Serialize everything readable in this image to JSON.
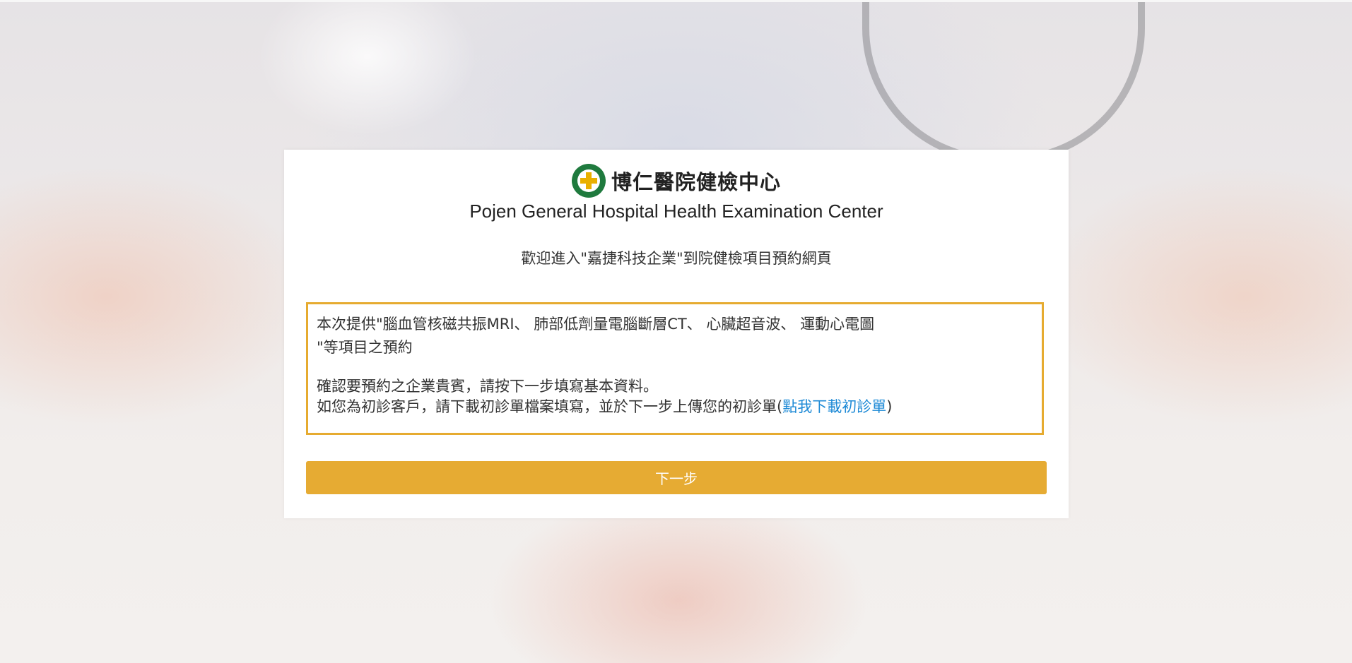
{
  "header": {
    "brand_name": "博仁醫院健檢中心",
    "english_title": "Pojen General Hospital Health Examination Center",
    "welcome": "歡迎進入\"嘉捷科技企業\"到院健檢項目預約網頁"
  },
  "notice": {
    "line1": "本次提供\"腦血管核磁共振MRI、 肺部低劑量電腦斷層CT、 心臟超音波、 運動心電圖",
    "line2": "\"等項目之預約",
    "line3": "確認要預約之企業貴賓，請按下一步填寫基本資料。",
    "line4_prefix": "如您為初診客戶，請下載初診單檔案填寫，並於下一步上傳您的初診單(",
    "download_link": "點我下載初診單",
    "line4_suffix": ")"
  },
  "actions": {
    "next_label": "下一步"
  },
  "colors": {
    "accent": "#e6ab33",
    "link": "#1e8ad6",
    "logo_green": "#1f7a3e"
  },
  "icons": {
    "logo": "hospital-cross-logo-icon"
  }
}
